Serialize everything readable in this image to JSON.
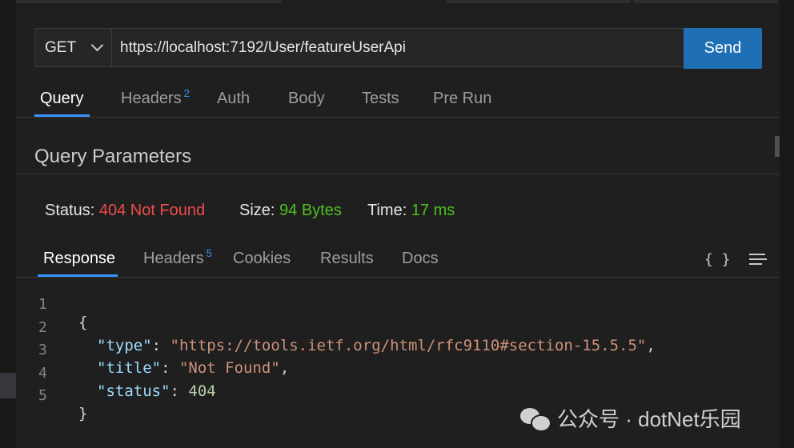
{
  "request": {
    "method": "GET",
    "url": "https://localhost:7192/User/featureUserApi",
    "send_label": "Send"
  },
  "request_tabs": [
    {
      "label": "Query",
      "badge": ""
    },
    {
      "label": "Headers",
      "badge": "2"
    },
    {
      "label": "Auth",
      "badge": ""
    },
    {
      "label": "Body",
      "badge": ""
    },
    {
      "label": "Tests",
      "badge": ""
    },
    {
      "label": "Pre Run",
      "badge": ""
    }
  ],
  "section_title": "Query Parameters",
  "status": {
    "status_label": "Status:",
    "status_value": "404 Not Found",
    "size_label": "Size:",
    "size_value": "94 Bytes",
    "time_label": "Time:",
    "time_value": "17 ms"
  },
  "response_tabs": [
    {
      "label": "Response",
      "badge": ""
    },
    {
      "label": "Headers",
      "badge": "5"
    },
    {
      "label": "Cookies",
      "badge": ""
    },
    {
      "label": "Results",
      "badge": ""
    },
    {
      "label": "Docs",
      "badge": ""
    }
  ],
  "toolbar": {
    "braces": "{ }"
  },
  "code": {
    "line_numbers": [
      "1",
      "2",
      "3",
      "4",
      "5"
    ],
    "open_brace": "{",
    "close_brace": "}",
    "key_type": "\"type\"",
    "val_type": "\"https://tools.ietf.org/html/rfc9110#section-15.5.5\"",
    "key_title": "\"title\"",
    "val_title": "\"Not Found\"",
    "key_status": "\"status\"",
    "val_status": "404"
  },
  "watermark": "公众号 · dotNet乐园",
  "colors": {
    "accent": "#3794ff",
    "send_button": "#1f6fb4",
    "error": "#f14c4c",
    "success": "#4ec020"
  }
}
